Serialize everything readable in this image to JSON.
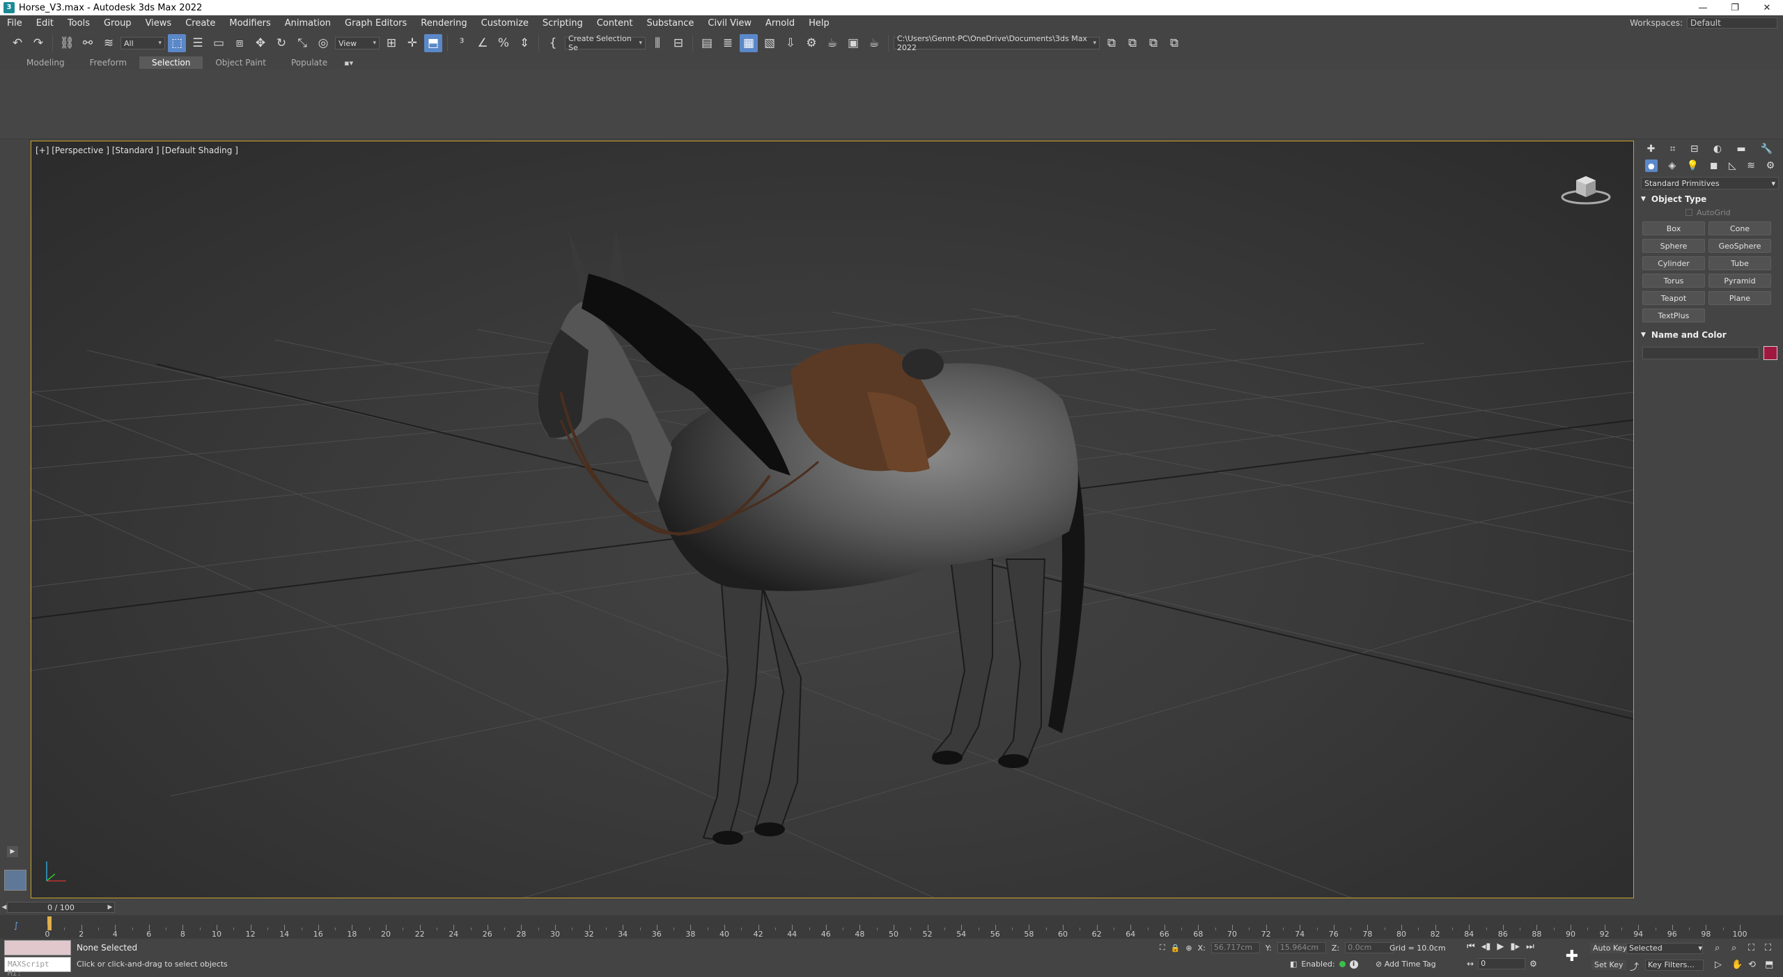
{
  "window": {
    "title": "Horse_V3.max - Autodesk 3ds Max 2022",
    "app_icon": "3",
    "minimize": "—",
    "maximize": "❐",
    "close": "✕"
  },
  "menu": {
    "items": [
      "File",
      "Edit",
      "Tools",
      "Group",
      "Views",
      "Create",
      "Modifiers",
      "Animation",
      "Graph Editors",
      "Rendering",
      "Customize",
      "Scripting",
      "Content",
      "Substance",
      "Civil View",
      "Arnold",
      "Help"
    ],
    "workspace_label": "Workspaces:",
    "workspace_value": "Default"
  },
  "toolbar": {
    "selection_filter": "All",
    "ref_coord": "View",
    "named_selection": "Create Selection Se",
    "project_path": "C:\\Users\\Gennt-PC\\OneDrive\\Documents\\3ds Max 2022"
  },
  "ribbon": {
    "tabs": [
      "Modeling",
      "Freeform",
      "Selection",
      "Object Paint",
      "Populate"
    ],
    "active_tab": "Selection"
  },
  "viewport": {
    "label": "[+] [Perspective ] [Standard ] [Default Shading ]"
  },
  "command_panel": {
    "category": "Standard Primitives",
    "object_type_title": "Object Type",
    "autogrid": "AutoGrid",
    "buttons": [
      "Box",
      "Cone",
      "Sphere",
      "GeoSphere",
      "Cylinder",
      "Tube",
      "Torus",
      "Pyramid",
      "Teapot",
      "Plane",
      "TextPlus"
    ],
    "name_color_title": "Name and Color",
    "color": "#a01840"
  },
  "time": {
    "slider": "0 / 100",
    "ticks": [
      0,
      2,
      4,
      6,
      8,
      10,
      12,
      14,
      16,
      18,
      20,
      22,
      24,
      26,
      28,
      30,
      32,
      34,
      36,
      38,
      40,
      42,
      44,
      46,
      48,
      50,
      52,
      54,
      56,
      58,
      60,
      62,
      64,
      66,
      68,
      70,
      72,
      74,
      76,
      78,
      80,
      82,
      84,
      86,
      88,
      90,
      92,
      94,
      96,
      98,
      100
    ],
    "current_frame": 0
  },
  "status": {
    "maxscript_placeholder": "MAXScript Mi:",
    "selection": "None Selected",
    "prompt": "Click or click-and-drag to select objects",
    "x_label": "X:",
    "x_value": "56.717cm",
    "y_label": "Y:",
    "y_value": "15.964cm",
    "z_label": "Z:",
    "z_value": "0.0cm",
    "grid": "Grid = 10.0cm",
    "enabled": "Enabled:",
    "add_time_tag": "Add Time Tag",
    "frame": "0",
    "auto_key": "Auto Key",
    "set_key": "Set Key",
    "key_mode": "Selected",
    "key_filters": "Key Filters..."
  }
}
